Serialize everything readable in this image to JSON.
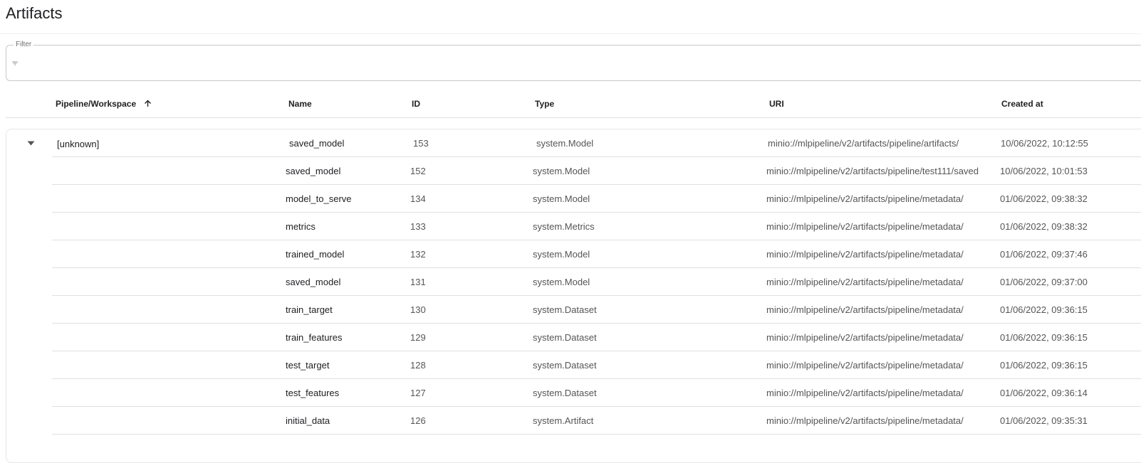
{
  "page": {
    "title": "Artifacts"
  },
  "filter": {
    "label": "Filter",
    "value": "",
    "placeholder": ""
  },
  "columns": {
    "pipeline": "Pipeline/Workspace",
    "name": "Name",
    "id": "ID",
    "type": "Type",
    "uri": "URI",
    "created": "Created at"
  },
  "sort": {
    "column": "Pipeline/Workspace",
    "direction": "ascending"
  },
  "group": {
    "label": "[unknown]",
    "expanded": true
  },
  "rows": [
    {
      "name": "saved_model",
      "id": "153",
      "type": "system.Model",
      "uri": "minio://mlpipeline/v2/artifacts/pipeline/artifacts/",
      "created": "10/06/2022, 10:12:55"
    },
    {
      "name": "saved_model",
      "id": "152",
      "type": "system.Model",
      "uri": "minio://mlpipeline/v2/artifacts/pipeline/test111/saved",
      "created": "10/06/2022, 10:01:53"
    },
    {
      "name": "model_to_serve",
      "id": "134",
      "type": "system.Model",
      "uri": "minio://mlpipeline/v2/artifacts/pipeline/metadata/",
      "created": "01/06/2022, 09:38:32"
    },
    {
      "name": "metrics",
      "id": "133",
      "type": "system.Metrics",
      "uri": "minio://mlpipeline/v2/artifacts/pipeline/metadata/",
      "created": "01/06/2022, 09:38:32"
    },
    {
      "name": "trained_model",
      "id": "132",
      "type": "system.Model",
      "uri": "minio://mlpipeline/v2/artifacts/pipeline/metadata/",
      "created": "01/06/2022, 09:37:46"
    },
    {
      "name": "saved_model",
      "id": "131",
      "type": "system.Model",
      "uri": "minio://mlpipeline/v2/artifacts/pipeline/metadata/",
      "created": "01/06/2022, 09:37:00"
    },
    {
      "name": "train_target",
      "id": "130",
      "type": "system.Dataset",
      "uri": "minio://mlpipeline/v2/artifacts/pipeline/metadata/",
      "created": "01/06/2022, 09:36:15"
    },
    {
      "name": "train_features",
      "id": "129",
      "type": "system.Dataset",
      "uri": "minio://mlpipeline/v2/artifacts/pipeline/metadata/",
      "created": "01/06/2022, 09:36:15"
    },
    {
      "name": "test_target",
      "id": "128",
      "type": "system.Dataset",
      "uri": "minio://mlpipeline/v2/artifacts/pipeline/metadata/",
      "created": "01/06/2022, 09:36:15"
    },
    {
      "name": "test_features",
      "id": "127",
      "type": "system.Dataset",
      "uri": "minio://mlpipeline/v2/artifacts/pipeline/metadata/",
      "created": "01/06/2022, 09:36:14"
    },
    {
      "name": "initial_data",
      "id": "126",
      "type": "system.Artifact",
      "uri": "minio://mlpipeline/v2/artifacts/pipeline/metadata/",
      "created": "01/06/2022, 09:35:31"
    }
  ]
}
